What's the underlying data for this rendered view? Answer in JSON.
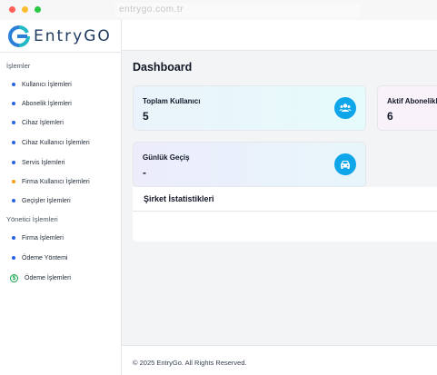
{
  "browser": {
    "url": "entrygo.com.tr"
  },
  "brand": {
    "name": "EntryGO",
    "colors": {
      "logo_blue": "#2b7fd6",
      "logo_teal": "#22b8c7",
      "text": "#1e3a5f"
    }
  },
  "sidebar": {
    "sections": [
      {
        "title": "İşlemler",
        "items": [
          {
            "label": "Kullanıcı İşlemleri",
            "icon": "dot"
          },
          {
            "label": "Abonelik İşlemleri",
            "icon": "dot"
          },
          {
            "label": "Cihaz İşlemleri",
            "icon": "dot"
          },
          {
            "label": "Cihaz Kullanıcı İşlemleri",
            "icon": "dot"
          },
          {
            "label": "Servis İşlemleri",
            "icon": "dot"
          },
          {
            "label": "Firma Kullanıcı İşlemleri",
            "icon": "dot-orange"
          },
          {
            "label": "Geçişler İşlemleri",
            "icon": "dot"
          }
        ]
      },
      {
        "title": "Yönetici İşlemleri",
        "items": [
          {
            "label": "Firma İşlemleri",
            "icon": "dot"
          },
          {
            "label": "Ödeme Yöntemi",
            "icon": "dot"
          },
          {
            "label": "Ödeme İşlemleri",
            "icon": "dollar-circle-icon",
            "icon_glyph": "$"
          }
        ]
      }
    ]
  },
  "main": {
    "title": "Dashboard",
    "cards": {
      "users": {
        "label": "Toplam Kullanıcı",
        "value": "5",
        "icon": "users-icon"
      },
      "subscriptions": {
        "label": "Aktif Abonelikler",
        "value": "6"
      },
      "daily": {
        "label": "Günlük Geçiş",
        "value": "-",
        "icon": "car-icon"
      }
    },
    "stats": {
      "title": "Şirket İstatistikleri"
    },
    "footer": "© 2025 EntryGo. All Rights Reserved.",
    "accent_color": "#0ea5e9"
  }
}
